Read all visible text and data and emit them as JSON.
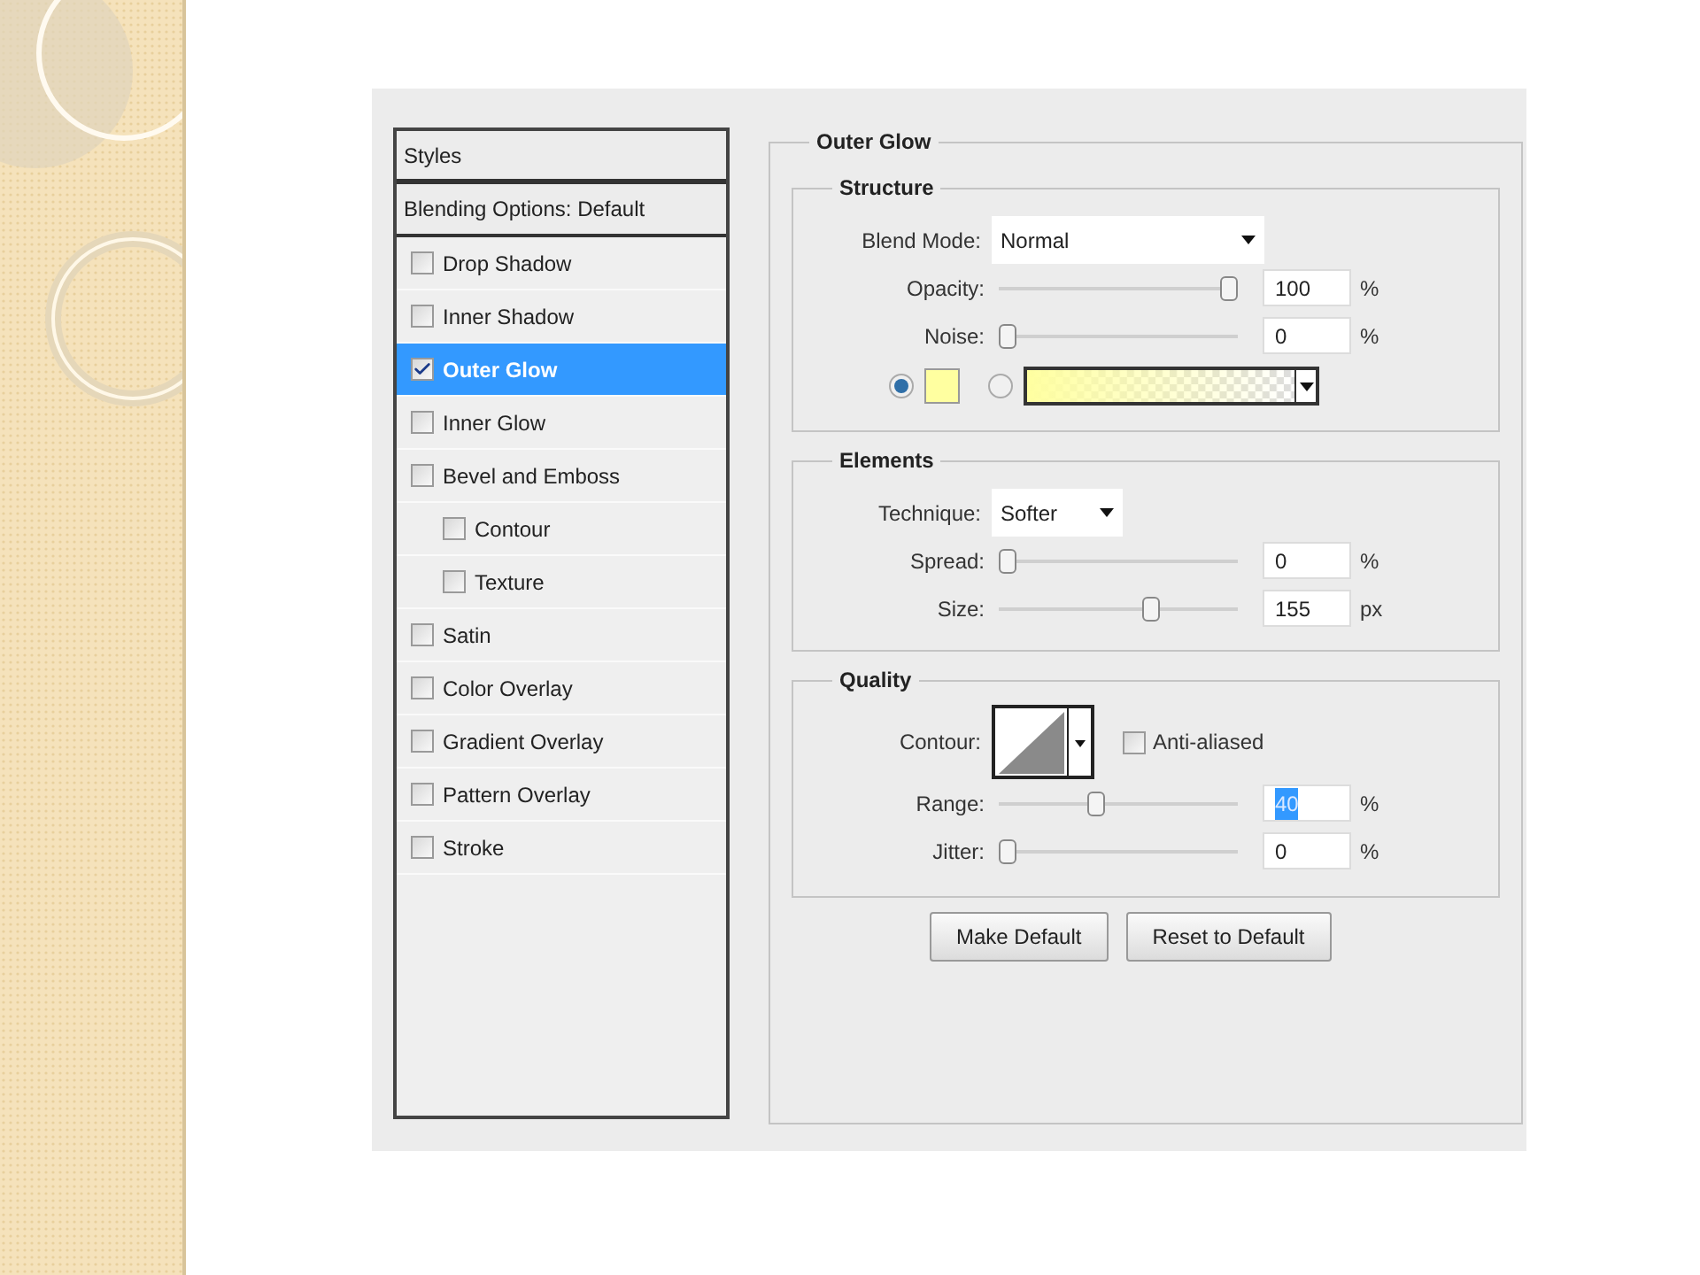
{
  "styles_panel": {
    "items": [
      {
        "kind": "header",
        "label": "Styles",
        "selected": false
      },
      {
        "kind": "header",
        "label": "Blending Options: Default",
        "selected": false
      },
      {
        "kind": "checkbox",
        "label": "Drop Shadow",
        "checked": false,
        "selected": false
      },
      {
        "kind": "checkbox",
        "label": "Inner Shadow",
        "checked": false,
        "selected": false
      },
      {
        "kind": "checkbox",
        "label": "Outer Glow",
        "checked": true,
        "selected": true
      },
      {
        "kind": "checkbox",
        "label": "Inner Glow",
        "checked": false,
        "selected": false
      },
      {
        "kind": "checkbox",
        "label": "Bevel and Emboss",
        "checked": false,
        "selected": false,
        "children": [
          {
            "kind": "checkbox",
            "label": "Contour",
            "checked": false,
            "selected": false
          },
          {
            "kind": "checkbox",
            "label": "Texture",
            "checked": false,
            "selected": false
          }
        ]
      },
      {
        "kind": "checkbox",
        "label": "Satin",
        "checked": false,
        "selected": false
      },
      {
        "kind": "checkbox",
        "label": "Color Overlay",
        "checked": false,
        "selected": false
      },
      {
        "kind": "checkbox",
        "label": "Gradient Overlay",
        "checked": false,
        "selected": false
      },
      {
        "kind": "checkbox",
        "label": "Pattern Overlay",
        "checked": false,
        "selected": false
      },
      {
        "kind": "checkbox",
        "label": "Stroke",
        "checked": false,
        "selected": false
      }
    ]
  },
  "outer_glow": {
    "title": "Outer Glow",
    "structure": {
      "title": "Structure",
      "blend_mode": {
        "label": "Blend Mode:",
        "value": "Normal"
      },
      "sliders": [
        {
          "label": "Opacity:",
          "level": 1,
          "value": "100",
          "unit": "%",
          "text_selected": false
        },
        {
          "label": "Noise:",
          "level": 0,
          "value": "0",
          "unit": "%",
          "text_selected": false
        }
      ],
      "fill_options": [
        {
          "kind": "solid",
          "selected": true,
          "color": "#ffffa0"
        },
        {
          "kind": "gradient",
          "selected": false,
          "color": "#ffffa0"
        }
      ]
    },
    "elements": {
      "title": "Elements",
      "technique": {
        "label": "Technique:",
        "value": "Softer"
      },
      "sliders": [
        {
          "label": "Spread:",
          "level": 0,
          "value": "0",
          "unit": "%",
          "text_selected": false
        },
        {
          "label": "Size:",
          "level": 0.65,
          "value": "155",
          "unit": "px",
          "text_selected": false
        }
      ]
    },
    "quality": {
      "title": "Quality",
      "contour": {
        "label": "Contour:"
      },
      "anti_aliased": {
        "label": "Anti-aliased",
        "checked": false
      },
      "sliders": [
        {
          "label": "Range:",
          "level": 0.4,
          "value": "40",
          "unit": "%",
          "text_selected": true
        },
        {
          "label": "Jitter:",
          "level": 0,
          "value": "0",
          "unit": "%",
          "text_selected": false
        }
      ]
    },
    "buttons": [
      "Make Default",
      "Reset to Default"
    ]
  }
}
